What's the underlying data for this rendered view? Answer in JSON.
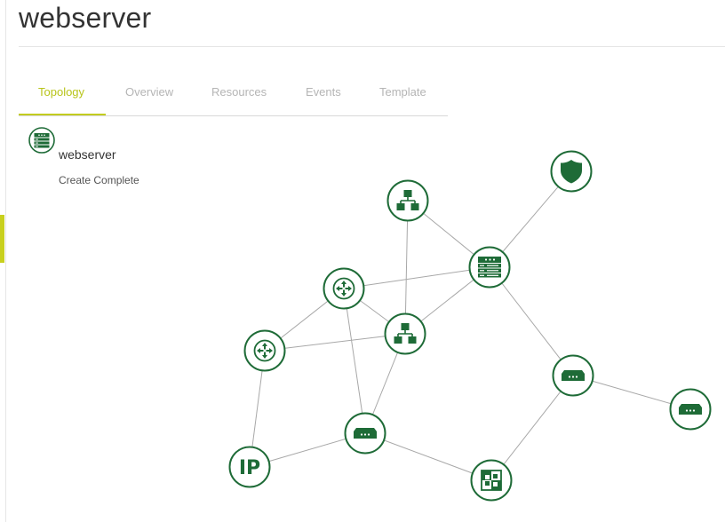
{
  "page": {
    "title": "webserver"
  },
  "tabs": [
    {
      "label": "Topology",
      "active": true
    },
    {
      "label": "Overview",
      "active": false
    },
    {
      "label": "Resources",
      "active": false
    },
    {
      "label": "Events",
      "active": false
    },
    {
      "label": "Template",
      "active": false
    }
  ],
  "stack": {
    "name": "webserver",
    "status": "Create Complete",
    "icon": "server-icon"
  },
  "colors": {
    "accent": "#c2cc1f",
    "node": "#1e6b37",
    "edge": "#a8a8a8"
  },
  "topology": {
    "nodes": [
      {
        "id": "security-group",
        "icon": "shield-icon"
      },
      {
        "id": "network-1",
        "icon": "network-icon"
      },
      {
        "id": "server",
        "icon": "server-icon"
      },
      {
        "id": "router-1",
        "icon": "router-icon"
      },
      {
        "id": "network-2",
        "icon": "network-icon"
      },
      {
        "id": "router-2",
        "icon": "router-icon"
      },
      {
        "id": "port-1",
        "icon": "port-icon"
      },
      {
        "id": "port-2",
        "icon": "port-icon"
      },
      {
        "id": "port-3",
        "icon": "port-icon"
      },
      {
        "id": "floating-ip",
        "icon": "ip-icon",
        "label": "IP"
      },
      {
        "id": "subnet",
        "icon": "subnet-icon"
      }
    ],
    "edges": [
      [
        "security-group",
        "server"
      ],
      [
        "network-1",
        "server"
      ],
      [
        "network-1",
        "network-2"
      ],
      [
        "router-1",
        "server"
      ],
      [
        "router-1",
        "network-2"
      ],
      [
        "router-1",
        "port-3"
      ],
      [
        "router-1",
        "router-2"
      ],
      [
        "server",
        "network-2"
      ],
      [
        "server",
        "port-1"
      ],
      [
        "router-2",
        "network-2"
      ],
      [
        "router-2",
        "floating-ip"
      ],
      [
        "network-2",
        "port-3"
      ],
      [
        "port-3",
        "floating-ip"
      ],
      [
        "port-3",
        "subnet"
      ],
      [
        "port-1",
        "port-2"
      ],
      [
        "port-1",
        "subnet"
      ]
    ]
  }
}
